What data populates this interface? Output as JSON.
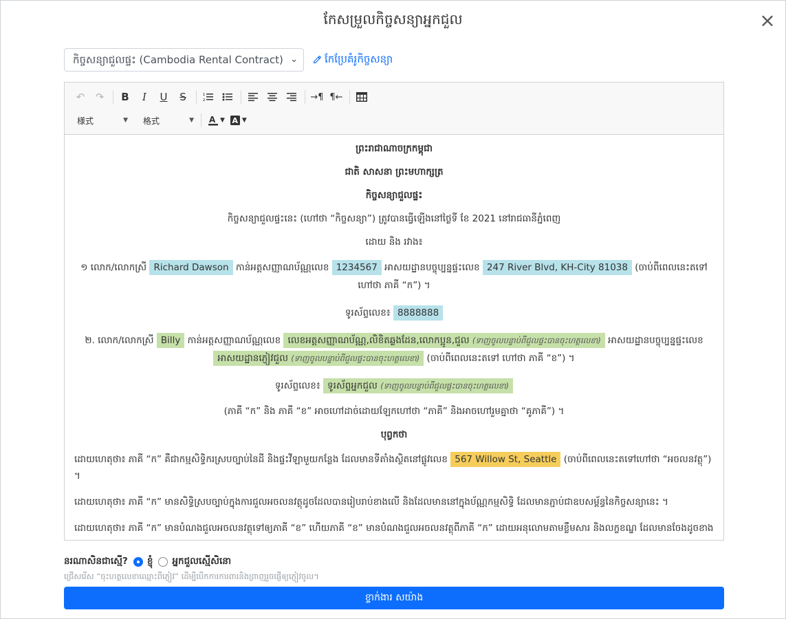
{
  "modal": {
    "title": "កែសម្រួលកិច្ចសន្យាអ្នកជួល",
    "close": "×"
  },
  "template": {
    "selected": "កិច្ចសន្យាជួលផ្ទះ (Cambodia Rental Contract)",
    "edit_link": "កែប្រែគំរូកិច្ចសន្យា"
  },
  "toolbar": {
    "style_combo": "様式",
    "format_combo": "格式",
    "icons": [
      "undo-icon",
      "redo-icon",
      "bold-icon",
      "italic-icon",
      "underline-icon",
      "strikethrough-icon",
      "ordered-list-icon",
      "bullet-list-icon",
      "align-left-icon",
      "align-center-icon",
      "align-right-icon",
      "ltr-icon",
      "rtl-icon",
      "table-icon",
      "text-color-icon",
      "background-color-icon"
    ]
  },
  "document": {
    "heading1": "ព្រះរាជាណាចក្រកម្ពុជា",
    "heading2": "ជាតិ សាសនា ព្រះមហាក្សត្រ",
    "heading3": "កិច្ចសន្យាជួលផ្ទះ",
    "intro": "កិច្ចសន្យាជួលផ្ទះនេះ (ហៅថា “កិច្ចសន្យា”) ត្រូវបានធ្វើឡើងនៅថ្ងៃទី ខែ 2021 នៅរាជធានីភ្នំពេញ",
    "between": "ដោយ និង រវាង៖",
    "party1": {
      "prefix": "១ លោក/លោកស្រី",
      "name": "Richard Dawson",
      "id_label": "កាន់អត្តសញ្ញាណប័ណ្ណលេខ",
      "id": "1234567",
      "addr_label": "អាសយដ្ឋានបច្ចុប្បន្នផ្ទះលេខ",
      "address": "247 River Blvd, KH-City 81038",
      "suffix": "(ចាប់ពីពេលនេះតទៅ ហៅថា ភាគី “ក”) ។",
      "phone_label": "ទូរស័ព្ទលេខ៖",
      "phone": "8888888"
    },
    "party2": {
      "prefix": "២. លោក/លោកស្រី",
      "name": "Billy",
      "id_label": "កាន់អត្តសញ្ញាណប័ណ្ណលេខ",
      "id_placeholder": "លេខអត្តសញ្ញាណប័ណ្ណ,លិខិតឆ្លងដែន,លោកប្អូន,ជួល",
      "id_hint": "(ទាញចូលបន្ទាប់ពីជួលផ្ទះបានចុះហត្ថលេខា)",
      "addr_label": "អាសយដ្ឋានបច្ចុប្បន្នផ្ទះលេខ",
      "addr_placeholder": "អាសយដ្ឋានភ្ញៀវជួល",
      "addr_hint": "(ទាញចូលបន្ទាប់ពីជួលផ្ទះបានចុះហត្ថលេខា)",
      "suffix": "(ចាប់ពីពេលនេះតទៅ ហៅថា ភាគី “ខ”) ។",
      "phone_label": "ទូរស័ព្ទលេខ៖",
      "phone_placeholder": "ទូរស័ព្ទអ្នកជួល",
      "phone_hint": "(ទាញចូលបន្ទាប់ពីជួលផ្ទះបានចុះហត្ថលេខា)"
    },
    "parties_note": "(ភាគី “ក” និង ភាគី “ខ” អាចហៅដាច់ដោយឡែកហៅថា “ភាគី” និងអាចហៅរួមគ្នាថា “គូភាគី”) ។",
    "preamble_title": "បុព្វកថា",
    "whereas1_a": "ដោយហេតុថា៖ ភាគី “ក” គឺជាកម្មសិទ្ធិករស្របច្បាប់នៃដី និងផ្ទះវីឡាមួយកន្លែង ដែលមានទីតាំងស្ថិតនៅផ្លូវលេខ",
    "property_address": "567 Willow St, Seattle",
    "whereas1_b": "(ចាប់ពីពេលនេះតទៅហៅថា “អចលនវត្ថុ”) ។",
    "whereas2": "ដោយហេតុថា៖ ភាគី “ក” មានសិទ្ធិស្របច្បាប់ក្នុងការជួលអចលនវត្ថុដូចដែលបានរៀបរាប់ខាងលើ និងដែលមាននៅក្នុងប័ណ្ណកម្មសិទ្ធិ ដែលមានភ្ជាប់ជាឧបសម្ព័ន្ធនៃកិច្ចសន្យានេះ ។",
    "whereas3": "ដោយហេតុថា៖ ភាគី “ក” មានបំណងជួលអចលនវត្ថុទៅឲ្យភាគី “ខ” ហើយភាគី “ខ” មានបំណងជួលអចលនវត្ថុពីភាគី “ក” ដោយអនុលោមតាមខ្លឹមសារ និងលក្ខខណ្ឌ ដែលមានចែងដូចខាងក្រោមនេះ ។"
  },
  "signer": {
    "question": "នរណាសិនជាស្មើ?",
    "option1": "ខ្ញុំ",
    "option2": "អ្នកជួលស្មើសិនោ",
    "help": "ជ្រើសរើស “ចុះហត្ថលេខាឈ្មោះពីភ្ញៀវ” ដើម្បីបើកការការពារនិងព្រាញរួចផ្ញើឲ្យភ្ញៀវចូល។"
  },
  "submit_label": "ខ្ទាក់ងារ សយ៉ាង"
}
